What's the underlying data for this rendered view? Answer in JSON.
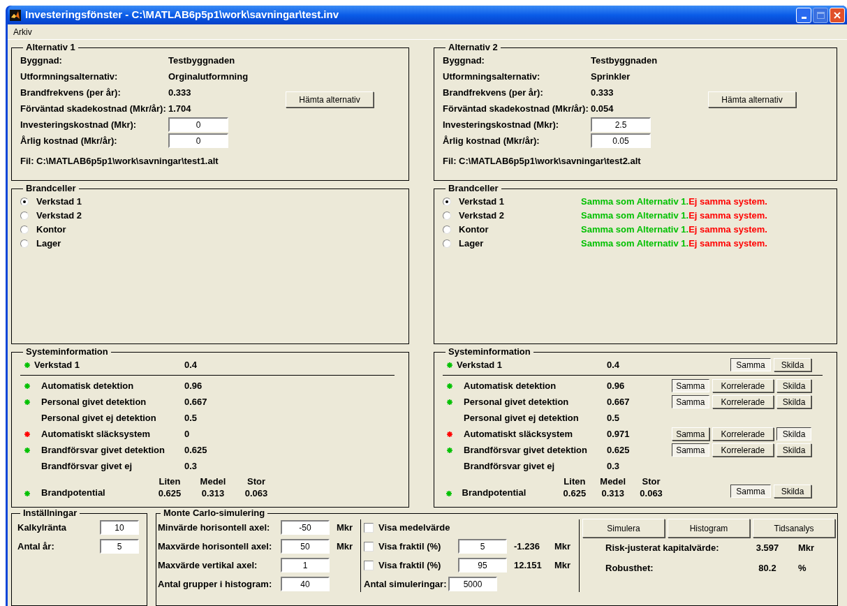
{
  "window": {
    "title": "Investeringsfönster - C:\\MATLAB6p5p1\\work\\savningar\\test.inv"
  },
  "menu": [
    "Arkiv"
  ],
  "alternatives": [
    {
      "title": "Alternativ 1",
      "fields": [
        {
          "kind": "text",
          "label": "Byggnad:",
          "value": "Testbyggnaden"
        },
        {
          "kind": "text",
          "label": "Utformningsalternativ:",
          "value": "Orginalutformning"
        },
        {
          "kind": "text",
          "label": "Brandfrekvens (per år):",
          "value": "0.333"
        },
        {
          "kind": "text",
          "label": "Förväntad skadekostnad (Mkr/år):",
          "value": "1.704"
        },
        {
          "kind": "input",
          "label": "Investeringskostnad (Mkr):",
          "value": "0"
        },
        {
          "kind": "input",
          "label": "Årlig kostnad (Mkr/år):",
          "value": "0"
        }
      ],
      "button": "Hämta alternativ",
      "file": "Fil: C:\\MATLAB6p5p1\\work\\savningar\\test1.alt"
    },
    {
      "title": "Alternativ 2",
      "fields": [
        {
          "kind": "text",
          "label": "Byggnad:",
          "value": "Testbyggnaden"
        },
        {
          "kind": "text",
          "label": "Utformningsalternativ:",
          "value": "Sprinkler"
        },
        {
          "kind": "text",
          "label": "Brandfrekvens (per år):",
          "value": "0.333"
        },
        {
          "kind": "text",
          "label": "Förväntad skadekostnad (Mkr/år):",
          "value": "0.054"
        },
        {
          "kind": "input",
          "label": "Investeringskostnad (Mkr):",
          "value": "2.5"
        },
        {
          "kind": "input",
          "label": "Årlig kostnad (Mkr/år):",
          "value": "0.05"
        }
      ],
      "button": "Hämta alternativ",
      "file": "Fil: C:\\MATLAB6p5p1\\work\\savningar\\test2.alt"
    }
  ],
  "brandceller": [
    {
      "title": "Brandceller",
      "cells": [
        {
          "name": "Verkstad 1",
          "selected": true
        },
        {
          "name": "Verkstad 2",
          "selected": false
        },
        {
          "name": "Kontor",
          "selected": false
        },
        {
          "name": "Lager",
          "selected": false
        }
      ]
    },
    {
      "title": "Brandceller",
      "cells": [
        {
          "name": "Verkstad 1",
          "selected": true,
          "notes": [
            {
              "text": "Samma som Alternativ 1.",
              "color": "#00c000"
            },
            {
              "text": "Ej samma system.",
              "color": "#ff0000"
            }
          ]
        },
        {
          "name": "Verkstad 2",
          "selected": false,
          "notes": [
            {
              "text": "Samma som Alternativ 1.",
              "color": "#00c000"
            },
            {
              "text": "Ej samma system.",
              "color": "#ff0000"
            }
          ]
        },
        {
          "name": "Kontor",
          "selected": false,
          "notes": [
            {
              "text": "Samma som Alternativ 1.",
              "color": "#00c000"
            },
            {
              "text": "Ej samma system.",
              "color": "#ff0000"
            }
          ]
        },
        {
          "name": "Lager",
          "selected": false,
          "notes": [
            {
              "text": "Samma som Alternativ 1.",
              "color": "#00c000"
            },
            {
              "text": "Ej samma system.",
              "color": "#ff0000"
            }
          ]
        }
      ]
    }
  ],
  "systeminfo": [
    {
      "title": "Systeminformation",
      "header": {
        "name": "Verkstad 1",
        "value": "0.4",
        "color": "#00c000"
      },
      "rows": [
        {
          "name": "Automatisk detektion",
          "value": "0.96",
          "color": "#00c000"
        },
        {
          "name": "Personal givet detektion",
          "value": "0.667",
          "color": "#00c000"
        },
        {
          "name": "Personal givet ej detektion",
          "value": "0.5"
        },
        {
          "name": "Automatiskt släcksystem",
          "value": "0",
          "color": "#ff0000"
        },
        {
          "name": "Brandförsvar givet detektion",
          "value": "0.625",
          "color": "#00c000"
        },
        {
          "name": "Brandförsvar givet ej",
          "value": "0.3"
        }
      ],
      "potential": {
        "name": "Brandpotential",
        "color": "#00c000",
        "columns": [
          {
            "label": "Liten",
            "value": "0.625"
          },
          {
            "label": "Medel",
            "value": "0.313"
          },
          {
            "label": "Stor",
            "value": "0.063"
          }
        ]
      }
    },
    {
      "title": "Systeminformation",
      "header": {
        "name": "Verkstad 1",
        "value": "0.4",
        "color": "#00c000",
        "buttons": [
          {
            "label": "Samma",
            "selected": true
          },
          {
            "label": "Skilda",
            "selected": false
          }
        ]
      },
      "rows": [
        {
          "name": "Automatisk detektion",
          "value": "0.96",
          "color": "#00c000",
          "buttons": [
            {
              "label": "Samma",
              "selected": true
            },
            {
              "label": "Korrelerade",
              "selected": false
            },
            {
              "label": "Skilda",
              "selected": false
            }
          ]
        },
        {
          "name": "Personal givet detektion",
          "value": "0.667",
          "color": "#00c000",
          "buttons": [
            {
              "label": "Samma",
              "selected": true
            },
            {
              "label": "Korrelerade",
              "selected": false
            },
            {
              "label": "Skilda",
              "selected": false
            }
          ]
        },
        {
          "name": "Personal givet ej detektion",
          "value": "0.5"
        },
        {
          "name": "Automatiskt släcksystem",
          "value": "0.971",
          "color": "#ff0000",
          "buttons": [
            {
              "label": "Samma",
              "selected": false
            },
            {
              "label": "Korrelerade",
              "selected": false
            },
            {
              "label": "Skilda",
              "selected": true
            }
          ]
        },
        {
          "name": "Brandförsvar givet detektion",
          "value": "0.625",
          "color": "#00c000",
          "buttons": [
            {
              "label": "Samma",
              "selected": true
            },
            {
              "label": "Korrelerade",
              "selected": false
            },
            {
              "label": "Skilda",
              "selected": false
            }
          ]
        },
        {
          "name": "Brandförsvar givet ej",
          "value": "0.3"
        }
      ],
      "potential": {
        "name": "Brandpotential",
        "color": "#00c000",
        "columns": [
          {
            "label": "Liten",
            "value": "0.625"
          },
          {
            "label": "Medel",
            "value": "0.313"
          },
          {
            "label": "Stor",
            "value": "0.063"
          }
        ],
        "buttons": [
          {
            "label": "Samma",
            "selected": true
          },
          {
            "label": "Skilda",
            "selected": false
          }
        ]
      }
    }
  ],
  "settings": {
    "title": "Inställningar",
    "fields": [
      {
        "label": "Kalkylränta",
        "value": "10"
      },
      {
        "label": "Antal år:",
        "value": "5"
      }
    ]
  },
  "monte_carlo": {
    "title": "Monte Carlo-simulering",
    "axes": [
      {
        "label": "Minvärde horisontell axel:",
        "value": "-50",
        "unit": "Mkr"
      },
      {
        "label": "Maxvärde horisontell axel:",
        "value": "50",
        "unit": "Mkr"
      },
      {
        "label": "Maxvärde vertikal axel:",
        "value": "1"
      },
      {
        "label": "Antal grupper i histogram:",
        "value": "40"
      }
    ],
    "options": [
      {
        "kind": "checkbox",
        "label": "Visa medelvärde",
        "checked": false
      },
      {
        "kind": "checkbox",
        "label": "Visa fraktil (%)",
        "checked": false,
        "value": "5",
        "result": "-1.236",
        "unit": "Mkr"
      },
      {
        "kind": "checkbox",
        "label": "Visa fraktil (%)",
        "checked": false,
        "value": "95",
        "result": "12.151",
        "unit": "Mkr"
      },
      {
        "kind": "input",
        "label": "Antal simuleringar:",
        "value": "5000"
      }
    ],
    "buttons": [
      "Simulera",
      "Histogram",
      "Tidsanalys"
    ],
    "results": [
      {
        "label": "Risk-justerat kapitalvärde:",
        "value": "3.597",
        "unit": "Mkr"
      },
      {
        "label": "Robusthet:",
        "value": "80.2",
        "unit": "%"
      }
    ]
  }
}
